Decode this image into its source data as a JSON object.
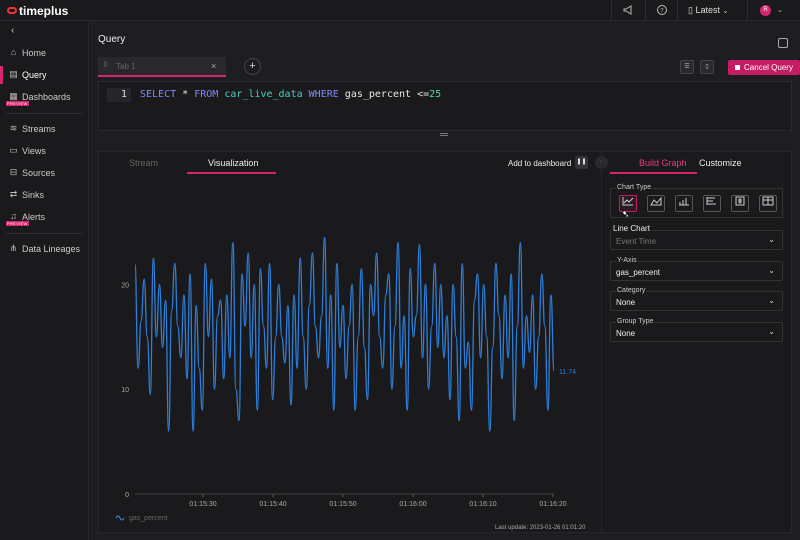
{
  "app": {
    "logo": "timeplus"
  },
  "topbar": {
    "latest_label": "Latest",
    "avatar_initial": "R"
  },
  "sidebar": {
    "items": [
      {
        "label": "Home",
        "icon": "home-icon"
      },
      {
        "label": "Query",
        "icon": "query-icon"
      },
      {
        "label": "Dashboards",
        "icon": "dashboard-icon",
        "badge": "PREVIEW"
      },
      {
        "label": "Streams",
        "icon": "streams-icon"
      },
      {
        "label": "Views",
        "icon": "views-icon"
      },
      {
        "label": "Sources",
        "icon": "sources-icon"
      },
      {
        "label": "Sinks",
        "icon": "sinks-icon"
      },
      {
        "label": "Alerts",
        "icon": "alerts-icon",
        "badge": "PREVIEW"
      },
      {
        "label": "Data Lineages",
        "icon": "lineage-icon"
      }
    ]
  },
  "page": {
    "title": "Query"
  },
  "tabs": {
    "tab1": "Tab 1",
    "add": "+",
    "cancel_query": "Cancel Query"
  },
  "editor": {
    "line_number": "1",
    "tokens": {
      "select": "SELECT",
      "star": "*",
      "from": "FROM",
      "table": "car_live_data",
      "where": "WHERE",
      "column": "gas_percent",
      "op": "<=",
      "value": "25"
    }
  },
  "viz": {
    "tab_stream": "Stream",
    "tab_visualization": "Visualization",
    "add_to_dashboard": "Add to dashboard",
    "last_update": "Last update: 2023-01-26 01:01:20"
  },
  "settings": {
    "tab_build": "Build Graph",
    "tab_customize": "Customize",
    "chart_type_label": "Chart Type",
    "chart_types": [
      "line-chart-icon",
      "area-chart-icon",
      "bar-chart-icon",
      "column-chart-icon",
      "single-value-icon",
      "table-icon"
    ],
    "tooltip": "Line Chart",
    "x_axis_value": "Event Time",
    "y_axis_label": "Y-Axis",
    "y_axis_value": "gas_percent",
    "category_label": "Category",
    "category_value": "None",
    "group_label": "Group Type",
    "group_value": "None"
  },
  "colors": {
    "accent": "#d7266f",
    "line": "#2f7fd8"
  },
  "chart_data": {
    "type": "line",
    "x_ticks": [
      "01:15:30",
      "01:15:40",
      "01:15:50",
      "01:16:00",
      "01:16:10",
      "01:16:20"
    ],
    "y_ticks": [
      "0",
      "10",
      "20"
    ],
    "ylim": [
      0,
      25
    ],
    "last_value_label": "11.74",
    "series": [
      {
        "name": "gas_percent",
        "values": [
          21.9,
          12,
          16.5,
          20.5,
          15,
          9.5,
          22.5,
          15,
          20,
          14,
          18.5,
          6,
          17.5,
          22,
          16,
          13,
          19,
          11,
          21,
          6,
          18,
          12,
          8,
          22,
          15,
          20.5,
          10,
          17,
          18.5,
          11,
          19,
          13,
          24,
          10,
          7,
          21,
          16,
          23,
          13,
          20,
          8,
          21.5,
          16,
          12,
          22,
          9,
          15,
          20,
          15,
          12.5,
          18,
          8.5,
          19,
          12,
          22.5,
          15,
          10,
          18,
          23,
          16,
          13,
          17,
          24.5,
          12,
          19,
          8,
          22,
          14,
          18,
          11,
          16,
          20,
          8,
          15,
          21.5,
          14,
          9,
          20,
          17,
          23,
          15,
          12,
          19,
          21,
          10,
          16,
          24,
          12,
          17,
          8,
          21.5,
          15,
          17,
          23.8,
          13,
          20,
          10,
          16,
          22,
          14,
          20,
          13,
          17,
          9,
          20,
          15,
          7,
          22,
          12,
          14.5,
          8,
          18.5,
          21,
          13,
          20,
          15,
          6,
          14,
          22,
          17,
          11,
          19,
          13,
          21,
          7,
          16,
          24,
          12,
          17,
          13.5,
          19,
          10,
          15,
          21,
          16,
          8,
          19,
          11.74
        ]
      }
    ]
  }
}
